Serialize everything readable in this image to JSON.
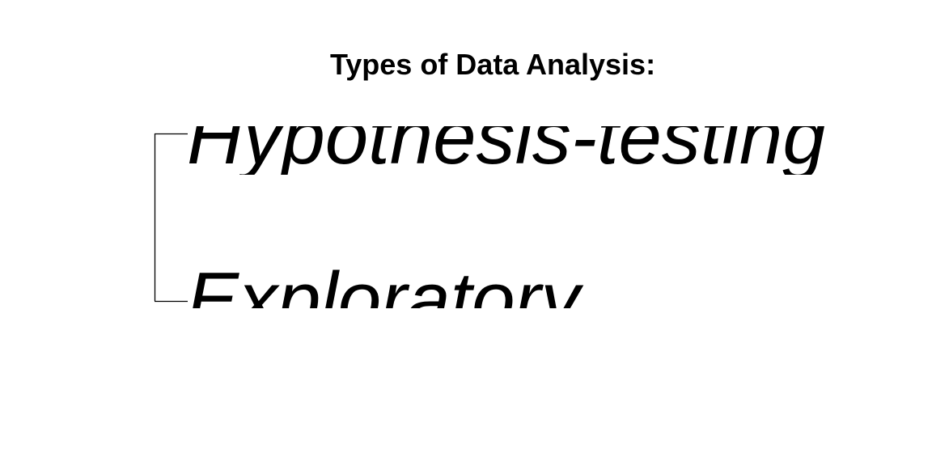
{
  "diagram": {
    "title": "Types of Data Analysis:",
    "branches": [
      {
        "label": "Hypothesis-testing"
      },
      {
        "label": "Exploratory"
      }
    ],
    "colors": {
      "background": "#ffffff",
      "text": "#000000",
      "connector": "#000000"
    }
  }
}
